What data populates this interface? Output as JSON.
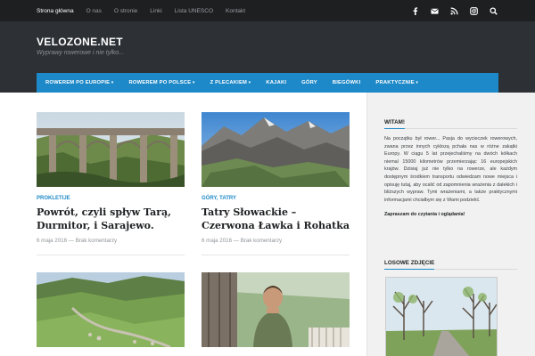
{
  "topbar": {
    "nav": [
      "Strona główna",
      "O nas",
      "O stronie",
      "Linki",
      "Lista UNESCO",
      "Kontakt"
    ],
    "social_icons": [
      "facebook-icon",
      "mail-icon",
      "rss-icon",
      "instagram-icon",
      "search-icon"
    ]
  },
  "header": {
    "title": "VELOZONE.NET",
    "description": "Wyprawy rowerowe i nie tylko..."
  },
  "mainnav": {
    "items": [
      {
        "label": "ROWEREM PO EUROPIE",
        "dropdown": true
      },
      {
        "label": "ROWEREM PO POLSCE",
        "dropdown": true
      },
      {
        "label": "Z PLECAKIEM",
        "dropdown": true
      },
      {
        "label": "KAJAKI",
        "dropdown": false
      },
      {
        "label": "GÓRY",
        "dropdown": false
      },
      {
        "label": "BIEGÓWKI",
        "dropdown": false
      },
      {
        "label": "PRAKTYCZNIE",
        "dropdown": true
      }
    ]
  },
  "posts": [
    {
      "category": "PROKLETIJE",
      "title": "Powrót, czyli spływ Tarą, Durmitor, i Sarajewo.",
      "date": "6 maja 2016",
      "comments": "Brak komentarzy"
    },
    {
      "category": "GÓRY, TATRY",
      "title": "Tatry Słowackie – Czerwona Ławka i Rohatka",
      "date": "6 maja 2016",
      "comments": "Brak komentarzy"
    },
    {},
    {}
  ],
  "meta_separator": "—",
  "sidebar": {
    "welcome_title": "WITAM!",
    "welcome_text": "Na początku był rower... Pasja do wycieczek rowerowych, zwana przez innych cyklozą pchała nas w różne zakątki Europy. W ciągu 5 lat przejechaliśmy na dwóch kółkach niemal 15000 kilometrów przemierzając 16 europejskich krajów. Dzisiaj już nie tylko na rowerze, ale każdym dostępnym środkiem transportu odwiedzam nowe miejsca i opisuję tutaj, aby ocalić od zapomnienia wrażenia z dalekich i bliższych wypraw. Tymi wrażeniami, a także praktycznymi informacjami chciałbym się z Wami podzielić.",
    "welcome_footer": "Zapraszam do czytania i oglądania!",
    "random_photo_title": "LOSOWE ZDJĘCIE"
  },
  "colors": {
    "accent": "#1e89c8",
    "topbar": "#1d1f21",
    "header": "#2d3035"
  }
}
